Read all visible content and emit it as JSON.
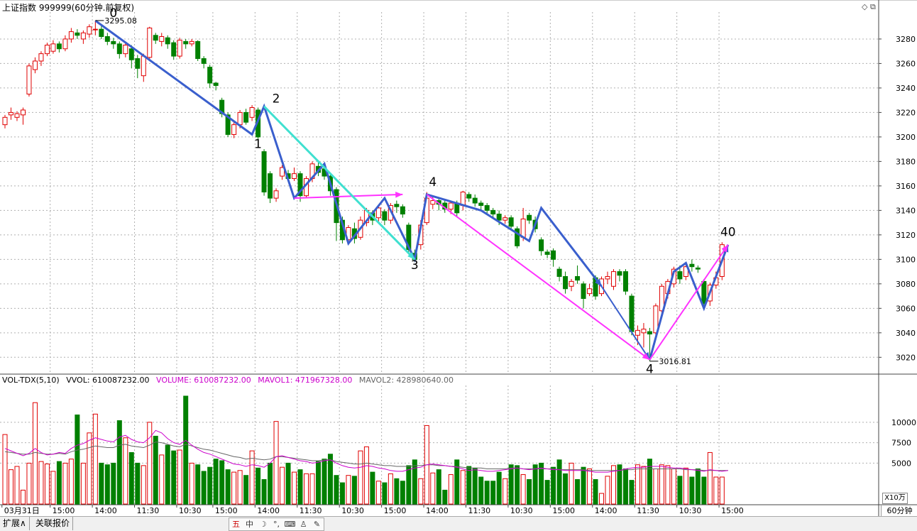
{
  "header": {
    "title": "上证指数 999999(60分钟.前复权)"
  },
  "volume_header": {
    "indicator": "VOL-TDX(5,10)",
    "vvol": "VVOL: 610087232.00",
    "volume": "VOLUME: 610087232.00",
    "mavol1": "MAVOL1: 471967328.00",
    "mavol2": "MAVOL2: 428980640.00"
  },
  "colors": {
    "up": "#e00000",
    "down": "#008000",
    "mavol1": "#cc00cc",
    "mavol2": "#666666",
    "wave_blue": "#3a5fcd",
    "wave_magenta": "#ff33ff",
    "wave_cyan": "#40e0d0",
    "grid": "#b0b0b0"
  },
  "annotations": {
    "high_label": "3295.08",
    "low_label": "3016.81",
    "wave_labels": [
      "0",
      "1",
      "2",
      "3",
      "4",
      "4",
      "40"
    ]
  },
  "unit_label": "X10万",
  "period_label": "60分钟",
  "tabs": [
    "扩展∧",
    "关联报价"
  ],
  "toolbar_icons": [
    "五",
    "中",
    "moon-icon",
    "dots-icon",
    "keyboard-icon",
    "user-icon",
    "wrench-icon"
  ],
  "corner_icons": "◇ ⧉",
  "chart_data": [
    {
      "type": "candlestick",
      "title": "上证指数 999999(60分钟.前复权)",
      "y_ticks": [
        3020,
        3040,
        3060,
        3080,
        3100,
        3120,
        3140,
        3160,
        3180,
        3200,
        3220,
        3240,
        3260,
        3280
      ],
      "ylim": [
        3008,
        3302
      ],
      "x_tick_labels": [
        "03月31日",
        "15:00",
        "14:00",
        "11:30",
        "10:30",
        "15:00",
        "14:00",
        "11:30",
        "10:30",
        "15:00",
        "14:00",
        "11:30",
        "10:30",
        "15:00",
        "14:00",
        "11:30",
        "10:30",
        "15:00"
      ],
      "x_tick_index": [
        0,
        8,
        15,
        22,
        29,
        35,
        42,
        49,
        56,
        63,
        70,
        77,
        84,
        91,
        98,
        105,
        112,
        119
      ],
      "grid": true,
      "candles": [
        [
          3210,
          3216,
          3207,
          3218
        ],
        [
          3218,
          3220,
          3214,
          3224
        ],
        [
          3216,
          3219,
          3213,
          3221
        ],
        [
          3218,
          3222,
          3210,
          3224
        ],
        [
          3235,
          3258,
          3233,
          3260
        ],
        [
          3255,
          3262,
          3252,
          3265
        ],
        [
          3262,
          3268,
          3258,
          3270
        ],
        [
          3268,
          3275,
          3266,
          3277
        ],
        [
          3270,
          3276,
          3268,
          3279
        ],
        [
          3276,
          3272,
          3269,
          3278
        ],
        [
          3272,
          3280,
          3270,
          3283
        ],
        [
          3280,
          3286,
          3277,
          3289
        ],
        [
          3285,
          3283,
          3280,
          3288
        ],
        [
          3280,
          3285,
          3276,
          3287
        ],
        [
          3284,
          3290,
          3281,
          3292
        ],
        [
          3288,
          3288,
          3283,
          3295.08
        ],
        [
          3288,
          3282,
          3280,
          3291
        ],
        [
          3282,
          3278,
          3275,
          3285
        ],
        [
          3278,
          3276,
          3272,
          3281
        ],
        [
          3276,
          3268,
          3264,
          3278
        ],
        [
          3268,
          3275,
          3265,
          3277
        ],
        [
          3272,
          3263,
          3256,
          3275
        ],
        [
          3264,
          3256,
          3248,
          3267
        ],
        [
          3250,
          3266,
          3245,
          3268
        ],
        [
          3265,
          3289,
          3262,
          3290
        ],
        [
          3283,
          3279,
          3276,
          3285
        ],
        [
          3278,
          3282,
          3274,
          3285
        ],
        [
          3281,
          3276,
          3272,
          3283
        ],
        [
          3277,
          3266,
          3263,
          3279
        ],
        [
          3266,
          3279,
          3264,
          3281
        ],
        [
          3278,
          3276,
          3272,
          3280
        ],
        [
          3276,
          3278,
          3274,
          3280
        ],
        [
          3278,
          3264,
          3262,
          3279
        ],
        [
          3264,
          3260,
          3256,
          3266
        ],
        [
          3257,
          3244,
          3240,
          3259
        ],
        [
          3244,
          3242,
          3238,
          3245
        ],
        [
          3230,
          3219,
          3216,
          3232
        ],
        [
          3218,
          3202,
          3200,
          3220
        ],
        [
          3202,
          3210,
          3199,
          3213
        ],
        [
          3210,
          3220,
          3207,
          3222
        ],
        [
          3220,
          3212,
          3210,
          3223
        ],
        [
          3216,
          3224,
          3213,
          3226
        ],
        [
          3222,
          3200,
          3196,
          3224
        ],
        [
          3188,
          3155,
          3152,
          3190
        ],
        [
          3170,
          3150,
          3146,
          3172
        ],
        [
          3150,
          3156,
          3147,
          3158
        ],
        [
          3168,
          3175,
          3165,
          3177
        ],
        [
          3170,
          3166,
          3163,
          3173
        ],
        [
          3166,
          3170,
          3164,
          3175
        ],
        [
          3170,
          3152,
          3147,
          3172
        ],
        [
          3152,
          3166,
          3150,
          3168
        ],
        [
          3166,
          3178,
          3163,
          3180
        ],
        [
          3176,
          3171,
          3168,
          3180
        ],
        [
          3174,
          3168,
          3165,
          3176
        ],
        [
          3168,
          3156,
          3152,
          3170
        ],
        [
          3157,
          3130,
          3115,
          3159
        ],
        [
          3132,
          3116,
          3113,
          3135
        ],
        [
          3116,
          3126,
          3112,
          3128
        ],
        [
          3125,
          3117,
          3113,
          3130
        ],
        [
          3118,
          3132,
          3116,
          3135
        ],
        [
          3130,
          3140,
          3127,
          3142
        ],
        [
          3138,
          3132,
          3128,
          3140
        ],
        [
          3134,
          3142,
          3131,
          3144
        ],
        [
          3139,
          3132,
          3128,
          3141
        ],
        [
          3132,
          3144,
          3129,
          3146
        ],
        [
          3145,
          3143,
          3138,
          3148
        ],
        [
          3143,
          3137,
          3134,
          3145
        ],
        [
          3128,
          3108,
          3104,
          3130
        ],
        [
          3105,
          3099.8,
          3098,
          3108
        ],
        [
          3112,
          3128,
          3108,
          3132
        ],
        [
          3130,
          3150,
          3128,
          3155
        ],
        [
          3145,
          3148,
          3141,
          3152
        ],
        [
          3148,
          3145,
          3140,
          3151
        ],
        [
          3146,
          3141,
          3138,
          3149
        ],
        [
          3141,
          3146,
          3137,
          3148
        ],
        [
          3146,
          3138,
          3135,
          3148
        ],
        [
          3144,
          3155,
          3140,
          3156
        ],
        [
          3153,
          3150,
          3147,
          3155
        ],
        [
          3150,
          3146,
          3143,
          3153
        ],
        [
          3146,
          3144,
          3140,
          3148
        ],
        [
          3144,
          3140,
          3137,
          3146
        ],
        [
          3140,
          3137,
          3134,
          3142
        ],
        [
          3137,
          3132,
          3128,
          3140
        ],
        [
          3132,
          3134,
          3129,
          3136
        ],
        [
          3134,
          3127,
          3125,
          3136
        ],
        [
          3125,
          3111,
          3109,
          3127
        ],
        [
          3118,
          3133,
          3115,
          3142
        ],
        [
          3136,
          3132,
          3129,
          3138
        ],
        [
          3132,
          3125,
          3122,
          3135
        ],
        [
          3116,
          3107,
          3103,
          3118
        ],
        [
          3106,
          3104,
          3101,
          3108
        ],
        [
          3107,
          3100,
          3094,
          3109
        ],
        [
          3092,
          3086,
          3082,
          3094
        ],
        [
          3086,
          3076,
          3072,
          3090
        ],
        [
          3078,
          3082,
          3074,
          3084
        ],
        [
          3086,
          3083,
          3080,
          3095
        ],
        [
          3080,
          3068,
          3060,
          3082
        ],
        [
          3072,
          3076,
          3070,
          3080
        ],
        [
          3085,
          3070,
          3067,
          3087
        ],
        [
          3072,
          3084,
          3070,
          3086
        ],
        [
          3084,
          3086,
          3080,
          3090
        ],
        [
          3078,
          3090,
          3075,
          3092
        ],
        [
          3090,
          3087,
          3082,
          3092
        ],
        [
          3090,
          3074,
          3071,
          3092
        ],
        [
          3070,
          3041,
          3038,
          3072
        ],
        [
          3038,
          3042,
          3030,
          3046
        ],
        [
          3040,
          3043,
          3028,
          3048
        ],
        [
          3041,
          3039,
          3016.81,
          3044
        ],
        [
          3040,
          3062,
          3038,
          3064
        ],
        [
          3058,
          3078,
          3055,
          3080
        ],
        [
          3072,
          3082,
          3068,
          3084
        ],
        [
          3080,
          3092,
          3077,
          3094
        ],
        [
          3090,
          3084,
          3080,
          3095
        ],
        [
          3086,
          3094,
          3083,
          3096
        ],
        [
          3096,
          3094,
          3090,
          3100
        ],
        [
          3093,
          3092,
          3089,
          3095
        ],
        [
          3082,
          3064,
          3062,
          3084
        ],
        [
          3066,
          3079,
          3062,
          3081
        ],
        [
          3079,
          3085,
          3076,
          3090
        ],
        [
          3086,
          3112,
          3083,
          3114
        ]
      ]
    },
    {
      "type": "bar",
      "title": "VOL-TDX(5,10)",
      "units": "X10万",
      "y_ticks": [
        5000,
        7500,
        10000
      ],
      "ylim": [
        0,
        14500
      ],
      "volumes_x10wan": [
        8500,
        4200,
        4600,
        1700,
        5000,
        12400,
        5200,
        4900,
        4000,
        5200,
        5000,
        5500,
        10900,
        5000,
        8700,
        11000,
        5000,
        4800,
        5000,
        10200,
        8100,
        6300,
        5000,
        4700,
        10000,
        8300,
        6000,
        7200,
        6500,
        6600,
        13200,
        5000,
        4800,
        4000,
        4500,
        5500,
        5300,
        4200,
        3900,
        4100,
        3500,
        6500,
        4400,
        3000,
        5000,
        10100,
        4500,
        5000,
        3900,
        4200,
        3700,
        3700,
        5200,
        5500,
        6100,
        3500,
        2600,
        3500,
        3400,
        6500,
        7000,
        3900,
        2800,
        2600,
        3700,
        3100,
        2800,
        4700,
        5400,
        3100,
        9600,
        3800,
        4200,
        1700,
        3600,
        5400,
        4100,
        4600,
        4400,
        3300,
        2800,
        2800,
        3900,
        3100,
        4800,
        4700,
        3600,
        3000,
        4800,
        5000,
        2900,
        4500,
        5400,
        3700,
        5000,
        3000,
        4500,
        4300,
        3000,
        1300,
        3400,
        4700,
        4800,
        4300,
        2900,
        4800,
        4600,
        5500,
        4300,
        4800,
        4700,
        4300,
        3400,
        4400,
        3300,
        4300,
        3300,
        6300,
        3300,
        3300,
        6100
      ],
      "mavol1_x10wan": [
        6800,
        6500,
        6200,
        5900,
        6200,
        6800,
        6300,
        6000,
        6100,
        6300,
        6200,
        6800,
        7200,
        7400,
        7800,
        8100,
        7900,
        7700,
        7600,
        8200,
        8400,
        7900,
        7600,
        7500,
        8100,
        9000,
        8700,
        8000,
        7500,
        7300,
        7800,
        7200,
        6700,
        6300,
        6100,
        5800,
        5500,
        5200,
        4900,
        4800,
        4600,
        4800,
        4700,
        4500,
        5000,
        5800,
        5900,
        5700,
        5500,
        5300,
        5200,
        5000,
        5100,
        5300,
        5400,
        5000,
        4700,
        4500,
        4400,
        4500,
        4700,
        4600,
        4400,
        4300,
        4100,
        4000,
        4000,
        4200,
        4400,
        4500,
        4800,
        4900,
        4800,
        4700,
        4600,
        4500,
        4300,
        4100,
        4200,
        4100,
        4000,
        4000,
        4100,
        4200,
        4300,
        4400,
        4300,
        4200,
        4300,
        4400,
        4300,
        4200,
        4200,
        4100,
        4100,
        4100,
        4100,
        4000,
        3900,
        3900,
        3900,
        4000,
        4100,
        4300,
        4400,
        4500,
        4500,
        4600,
        4600,
        4600,
        4500,
        4400,
        4400,
        4300,
        4200,
        4100,
        4000,
        4200,
        4100,
        4000,
        4100
      ],
      "mavol2_x10wan": [
        6400,
        6300,
        6200,
        6100,
        6100,
        6300,
        6200,
        6100,
        6100,
        6200,
        6100,
        6400,
        6600,
        6700,
        6900,
        7100,
        7000,
        6900,
        6900,
        7200,
        7300,
        7100,
        7000,
        6900,
        7200,
        7600,
        7500,
        7300,
        7100,
        7000,
        7300,
        7100,
        6900,
        6700,
        6600,
        6400,
        6200,
        6000,
        5800,
        5700,
        5500,
        5600,
        5500,
        5400,
        5500,
        5800,
        5800,
        5700,
        5600,
        5500,
        5400,
        5300,
        5300,
        5400,
        5400,
        5200,
        5100,
        5000,
        4900,
        4900,
        5000,
        4900,
        4800,
        4700,
        4700,
        4600,
        4600,
        4600,
        4700,
        4700,
        4800,
        4800,
        4700,
        4700,
        4600,
        4600,
        4500,
        4400,
        4400,
        4400,
        4300,
        4300,
        4300,
        4300,
        4400,
        4400,
        4300,
        4300,
        4300,
        4300,
        4300,
        4300,
        4200,
        4200,
        4200,
        4200,
        4200,
        4100,
        4100,
        4100,
        4100,
        4100,
        4100,
        4200,
        4200,
        4300,
        4300,
        4300,
        4300,
        4300,
        4300,
        4300,
        4300,
        4200,
        4200,
        4200,
        4100,
        4100,
        4100,
        4100,
        4100
      ]
    }
  ],
  "wave_lines": [
    {
      "color": "wave_blue",
      "width": 3,
      "points": [
        [
          15,
          3295
        ],
        [
          41,
          3202
        ],
        [
          43,
          3225
        ],
        [
          48,
          3150
        ],
        [
          53,
          3178
        ],
        [
          57,
          3113
        ],
        [
          63,
          3150
        ],
        [
          68,
          3100
        ],
        [
          70,
          3153
        ],
        [
          79,
          3140
        ],
        [
          87,
          3115
        ],
        [
          89,
          3142
        ],
        [
          99,
          3078
        ]
      ]
    },
    {
      "color": "wave_blue",
      "width": 3,
      "points": [
        [
          107,
          3018
        ],
        [
          111,
          3090
        ],
        [
          113,
          3097
        ],
        [
          116,
          3060
        ],
        [
          120,
          3112
        ]
      ]
    },
    {
      "color": "wave_blue",
      "width": 2,
      "points": [
        [
          99,
          3078
        ],
        [
          107,
          3018
        ]
      ]
    },
    {
      "color": "wave_magenta",
      "width": 2,
      "points": [
        [
          48,
          3150
        ],
        [
          66,
          3153
        ]
      ]
    },
    {
      "color": "wave_magenta",
      "width": 2,
      "points": [
        [
          70,
          3153
        ],
        [
          107,
          3018
        ]
      ]
    },
    {
      "color": "wave_magenta",
      "width": 2,
      "points": [
        [
          107,
          3018
        ],
        [
          120,
          3112
        ]
      ]
    },
    {
      "color": "wave_cyan",
      "width": 3,
      "points": [
        [
          43,
          3225
        ],
        [
          68,
          3100
        ]
      ]
    }
  ]
}
